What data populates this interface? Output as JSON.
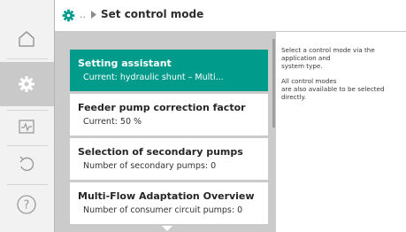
{
  "header": {
    "breadcrumb_dots": "..",
    "title": "Set control mode",
    "icon": "gear-icon",
    "accent": "#009b8b"
  },
  "sidebar": {
    "items": [
      {
        "icon": "home-icon",
        "active": false
      },
      {
        "icon": "gear-icon",
        "active": true
      },
      {
        "icon": "diagnostics-icon",
        "active": false
      },
      {
        "icon": "undo-icon",
        "active": false
      },
      {
        "icon": "help-icon",
        "active": false
      }
    ]
  },
  "menu": {
    "items": [
      {
        "label": "Setting assistant",
        "sub": "Current: hydraulic shunt – Multi...",
        "active": true
      },
      {
        "label": "Feeder pump correction factor",
        "sub": "Current: 50 %",
        "active": false
      },
      {
        "label": "Selection of secondary pumps",
        "sub": "Number of secondary pumps: 0",
        "active": false
      },
      {
        "label": "Multi-Flow Adaptation Overview",
        "sub": "Number of consumer circuit pumps: 0",
        "active": false
      }
    ],
    "scroll_down_icon": "chevron-down-icon"
  },
  "help": {
    "paragraph_1": "Select a control mode via the\napplication and\nsystem type.",
    "paragraph_2": "All control modes\nare also available to be selected\ndirectly."
  },
  "colors": {
    "accent": "#009b8b",
    "menu_background": "#cbcbcb",
    "sidebar_background": "#f2f2f2",
    "sidebar_active": "#c9c9c9"
  }
}
